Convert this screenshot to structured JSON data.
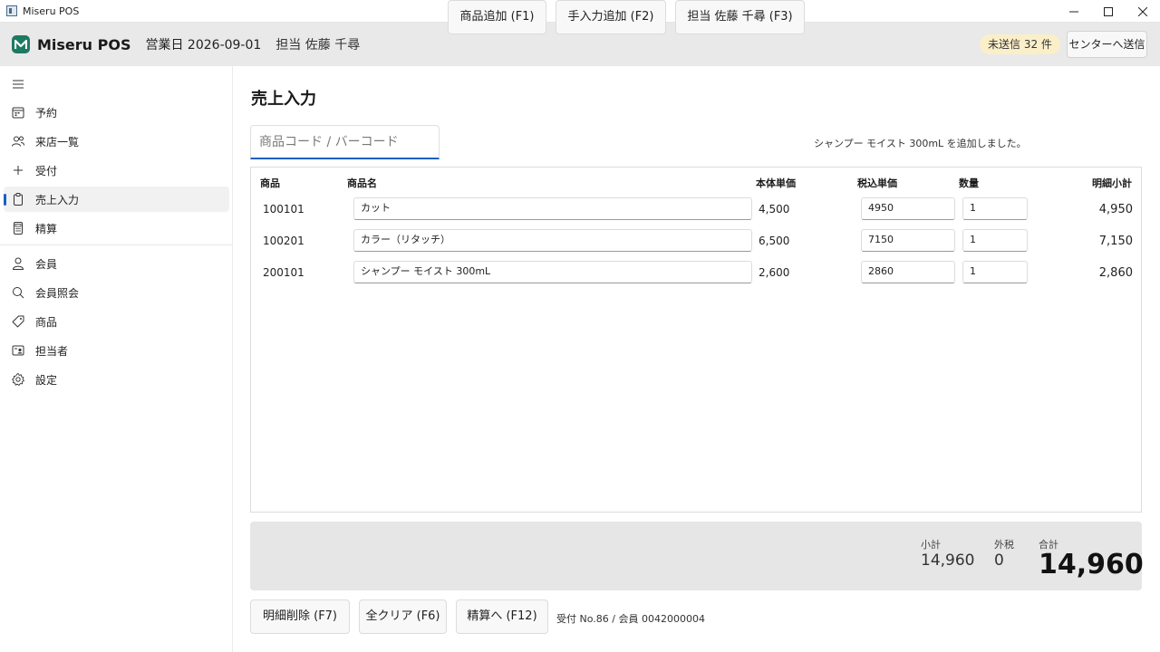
{
  "window": {
    "title": "Miseru POS"
  },
  "header": {
    "app_name": "Miseru POS",
    "business_date": "営業日 2026-09-01",
    "staff": "担当 佐藤 千尋",
    "unsent_badge": "未送信 32 件",
    "send_button": "センターへ送信"
  },
  "sidebar": {
    "items": [
      {
        "label": "予約",
        "icon": "calendar-icon"
      },
      {
        "label": "来店一覧",
        "icon": "people-icon"
      },
      {
        "label": "受付",
        "icon": "plus-icon"
      },
      {
        "label": "売上入力",
        "icon": "clipboard-icon",
        "active": true
      },
      {
        "label": "精算",
        "icon": "calculator-icon"
      },
      {
        "label": "会員",
        "icon": "person-icon"
      },
      {
        "label": "会員照会",
        "icon": "search-icon"
      },
      {
        "label": "商品",
        "icon": "tag-icon"
      },
      {
        "label": "担当者",
        "icon": "contact-card-icon"
      },
      {
        "label": "設定",
        "icon": "gear-icon"
      }
    ]
  },
  "main": {
    "title": "売上入力",
    "code_input": {
      "placeholder": "商品コード / バーコード",
      "value": ""
    },
    "buttons": {
      "add_product": "商品追加 (F1)",
      "manual_add": "手入力追加 (F2)",
      "staff": "担当 佐藤 千尋 (F3)"
    },
    "status_message": "シャンプー モイスト 300mL を追加しました。",
    "table": {
      "headers": [
        "商品",
        "商品名",
        "本体単価",
        "税込単価",
        "数量",
        "明細小計"
      ],
      "rows": [
        {
          "code": "100101",
          "name": "カット",
          "base_price": "4,500",
          "tax_price": "4950",
          "qty": "1",
          "subtotal": "4,950"
        },
        {
          "code": "100201",
          "name": "カラー（リタッチ）",
          "base_price": "6,500",
          "tax_price": "7150",
          "qty": "1",
          "subtotal": "7,150"
        },
        {
          "code": "200101",
          "name": "シャンプー モイスト 300mL",
          "base_price": "2,600",
          "tax_price": "2860",
          "qty": "1",
          "subtotal": "2,860"
        }
      ]
    },
    "totals": {
      "subtotal_label": "小計",
      "subtotal": "14,960",
      "tax_label": "外税",
      "tax": "0",
      "total_label": "合計",
      "total": "14,960"
    },
    "footer": {
      "delete_line": "明細削除 (F7)",
      "clear_all": "全クリア (F6)",
      "checkout": "精算へ (F12)",
      "info": "受付 No.86 / 会員 0042000004"
    }
  },
  "colors": {
    "accent": "#1b5fc1",
    "brand": "#1e7a62",
    "badge_bg": "#fbefc9"
  }
}
